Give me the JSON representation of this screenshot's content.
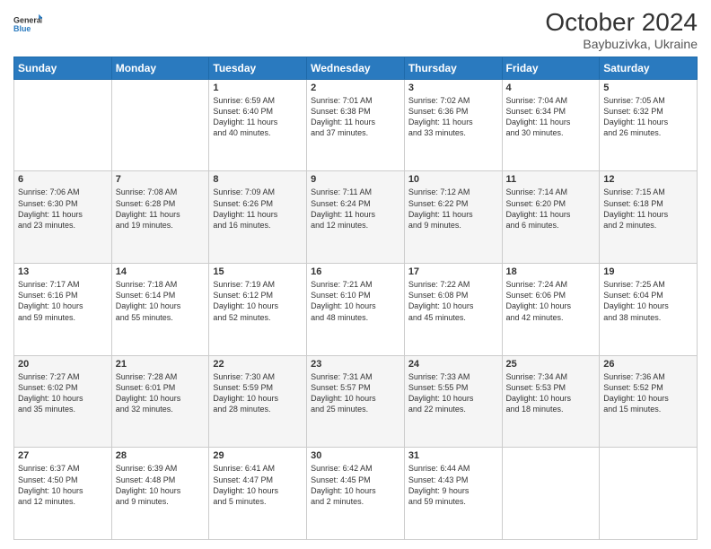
{
  "header": {
    "logo_line1": "General",
    "logo_line2": "Blue",
    "title": "October 2024",
    "subtitle": "Baybuzivka, Ukraine"
  },
  "days_of_week": [
    "Sunday",
    "Monday",
    "Tuesday",
    "Wednesday",
    "Thursday",
    "Friday",
    "Saturday"
  ],
  "weeks": [
    [
      {
        "day": "",
        "info": ""
      },
      {
        "day": "",
        "info": ""
      },
      {
        "day": "1",
        "info": "Sunrise: 6:59 AM\nSunset: 6:40 PM\nDaylight: 11 hours\nand 40 minutes."
      },
      {
        "day": "2",
        "info": "Sunrise: 7:01 AM\nSunset: 6:38 PM\nDaylight: 11 hours\nand 37 minutes."
      },
      {
        "day": "3",
        "info": "Sunrise: 7:02 AM\nSunset: 6:36 PM\nDaylight: 11 hours\nand 33 minutes."
      },
      {
        "day": "4",
        "info": "Sunrise: 7:04 AM\nSunset: 6:34 PM\nDaylight: 11 hours\nand 30 minutes."
      },
      {
        "day": "5",
        "info": "Sunrise: 7:05 AM\nSunset: 6:32 PM\nDaylight: 11 hours\nand 26 minutes."
      }
    ],
    [
      {
        "day": "6",
        "info": "Sunrise: 7:06 AM\nSunset: 6:30 PM\nDaylight: 11 hours\nand 23 minutes."
      },
      {
        "day": "7",
        "info": "Sunrise: 7:08 AM\nSunset: 6:28 PM\nDaylight: 11 hours\nand 19 minutes."
      },
      {
        "day": "8",
        "info": "Sunrise: 7:09 AM\nSunset: 6:26 PM\nDaylight: 11 hours\nand 16 minutes."
      },
      {
        "day": "9",
        "info": "Sunrise: 7:11 AM\nSunset: 6:24 PM\nDaylight: 11 hours\nand 12 minutes."
      },
      {
        "day": "10",
        "info": "Sunrise: 7:12 AM\nSunset: 6:22 PM\nDaylight: 11 hours\nand 9 minutes."
      },
      {
        "day": "11",
        "info": "Sunrise: 7:14 AM\nSunset: 6:20 PM\nDaylight: 11 hours\nand 6 minutes."
      },
      {
        "day": "12",
        "info": "Sunrise: 7:15 AM\nSunset: 6:18 PM\nDaylight: 11 hours\nand 2 minutes."
      }
    ],
    [
      {
        "day": "13",
        "info": "Sunrise: 7:17 AM\nSunset: 6:16 PM\nDaylight: 10 hours\nand 59 minutes."
      },
      {
        "day": "14",
        "info": "Sunrise: 7:18 AM\nSunset: 6:14 PM\nDaylight: 10 hours\nand 55 minutes."
      },
      {
        "day": "15",
        "info": "Sunrise: 7:19 AM\nSunset: 6:12 PM\nDaylight: 10 hours\nand 52 minutes."
      },
      {
        "day": "16",
        "info": "Sunrise: 7:21 AM\nSunset: 6:10 PM\nDaylight: 10 hours\nand 48 minutes."
      },
      {
        "day": "17",
        "info": "Sunrise: 7:22 AM\nSunset: 6:08 PM\nDaylight: 10 hours\nand 45 minutes."
      },
      {
        "day": "18",
        "info": "Sunrise: 7:24 AM\nSunset: 6:06 PM\nDaylight: 10 hours\nand 42 minutes."
      },
      {
        "day": "19",
        "info": "Sunrise: 7:25 AM\nSunset: 6:04 PM\nDaylight: 10 hours\nand 38 minutes."
      }
    ],
    [
      {
        "day": "20",
        "info": "Sunrise: 7:27 AM\nSunset: 6:02 PM\nDaylight: 10 hours\nand 35 minutes."
      },
      {
        "day": "21",
        "info": "Sunrise: 7:28 AM\nSunset: 6:01 PM\nDaylight: 10 hours\nand 32 minutes."
      },
      {
        "day": "22",
        "info": "Sunrise: 7:30 AM\nSunset: 5:59 PM\nDaylight: 10 hours\nand 28 minutes."
      },
      {
        "day": "23",
        "info": "Sunrise: 7:31 AM\nSunset: 5:57 PM\nDaylight: 10 hours\nand 25 minutes."
      },
      {
        "day": "24",
        "info": "Sunrise: 7:33 AM\nSunset: 5:55 PM\nDaylight: 10 hours\nand 22 minutes."
      },
      {
        "day": "25",
        "info": "Sunrise: 7:34 AM\nSunset: 5:53 PM\nDaylight: 10 hours\nand 18 minutes."
      },
      {
        "day": "26",
        "info": "Sunrise: 7:36 AM\nSunset: 5:52 PM\nDaylight: 10 hours\nand 15 minutes."
      }
    ],
    [
      {
        "day": "27",
        "info": "Sunrise: 6:37 AM\nSunset: 4:50 PM\nDaylight: 10 hours\nand 12 minutes."
      },
      {
        "day": "28",
        "info": "Sunrise: 6:39 AM\nSunset: 4:48 PM\nDaylight: 10 hours\nand 9 minutes."
      },
      {
        "day": "29",
        "info": "Sunrise: 6:41 AM\nSunset: 4:47 PM\nDaylight: 10 hours\nand 5 minutes."
      },
      {
        "day": "30",
        "info": "Sunrise: 6:42 AM\nSunset: 4:45 PM\nDaylight: 10 hours\nand 2 minutes."
      },
      {
        "day": "31",
        "info": "Sunrise: 6:44 AM\nSunset: 4:43 PM\nDaylight: 9 hours\nand 59 minutes."
      },
      {
        "day": "",
        "info": ""
      },
      {
        "day": "",
        "info": ""
      }
    ]
  ]
}
